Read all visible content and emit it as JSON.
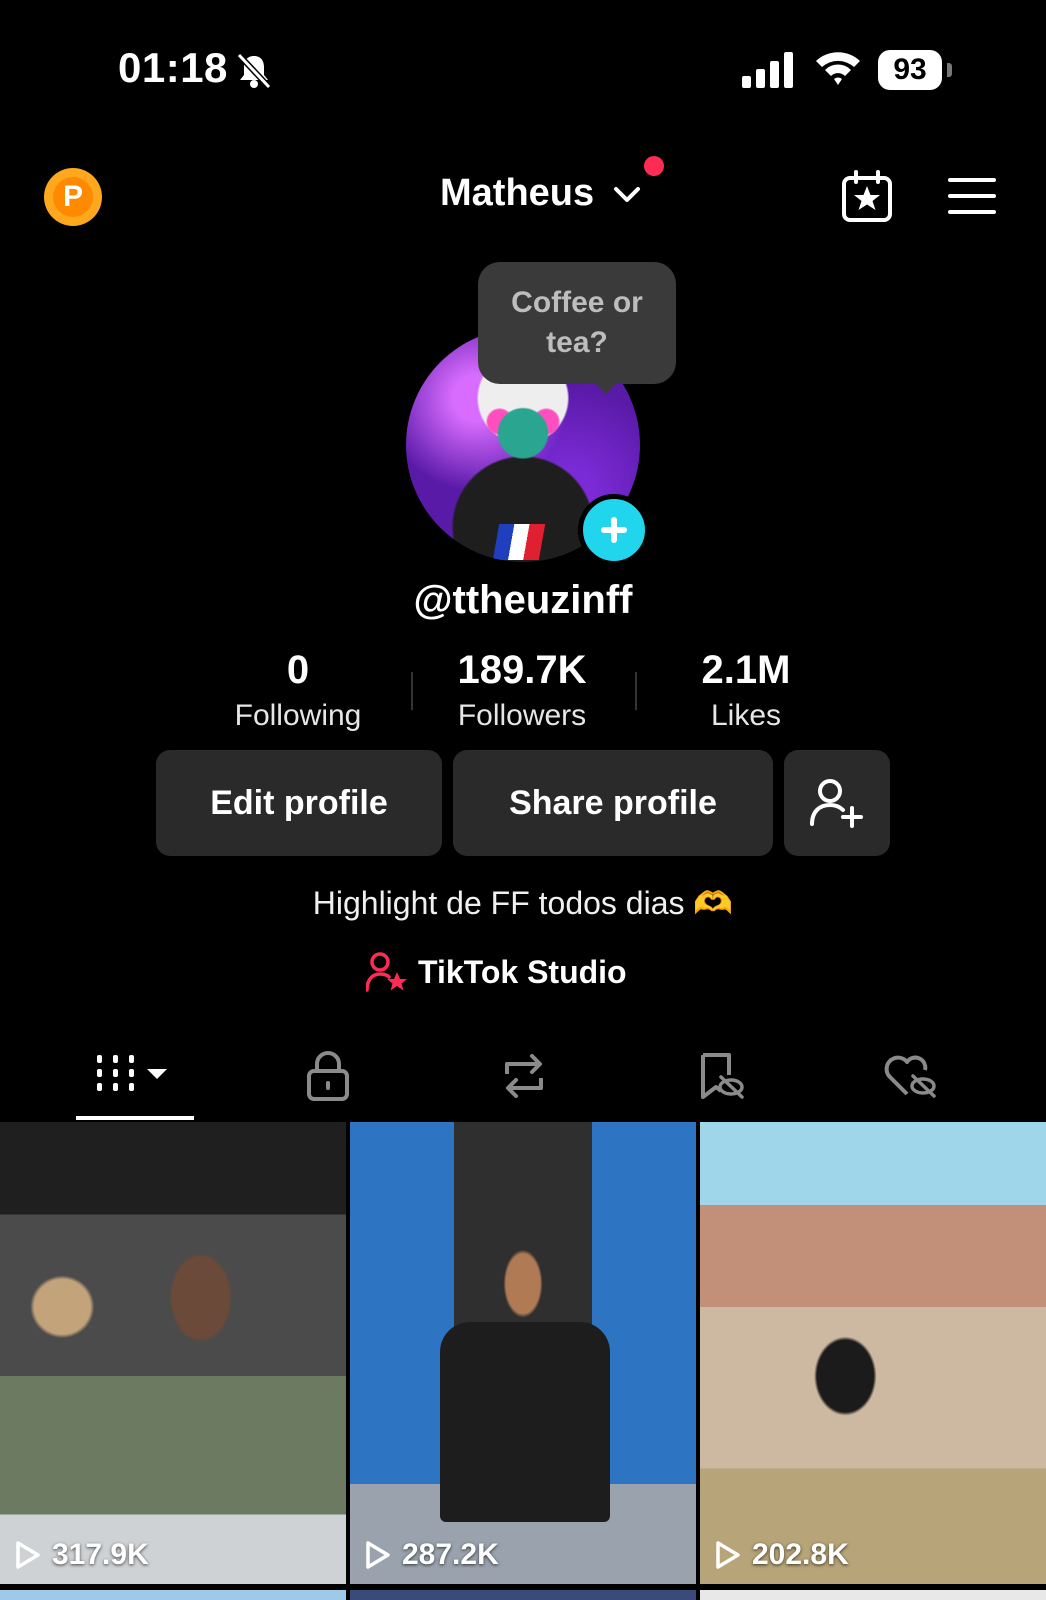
{
  "status_bar": {
    "time": "01:18",
    "battery": "93"
  },
  "header": {
    "username": "Matheus",
    "coin_letter": "P"
  },
  "profile": {
    "tooltip": "Coffee or tea?",
    "handle": "@ttheuzinff",
    "stats": [
      {
        "value": "0",
        "label": "Following"
      },
      {
        "value": "189.7K",
        "label": "Followers"
      },
      {
        "value": "2.1M",
        "label": "Likes"
      }
    ],
    "buttons": {
      "edit": "Edit profile",
      "share": "Share profile"
    },
    "bio": "Highlight de FF todos dias 🫶",
    "studio_label": "TikTok Studio"
  },
  "videos": [
    {
      "views": "317.9K"
    },
    {
      "views": "287.2K"
    },
    {
      "views": "202.8K"
    }
  ],
  "colors": {
    "accent_red": "#fe2c55",
    "accent_cyan": "#20d5ec",
    "button_bg": "#2a2a2a"
  },
  "icons": [
    "bell-muted-icon",
    "signal-icon",
    "wifi-icon",
    "calendar-star-icon",
    "menu-icon",
    "add-friend-icon",
    "grid-icon",
    "lock-icon",
    "repost-icon",
    "bookmark-hidden-icon",
    "heart-hidden-icon",
    "play-icon"
  ]
}
